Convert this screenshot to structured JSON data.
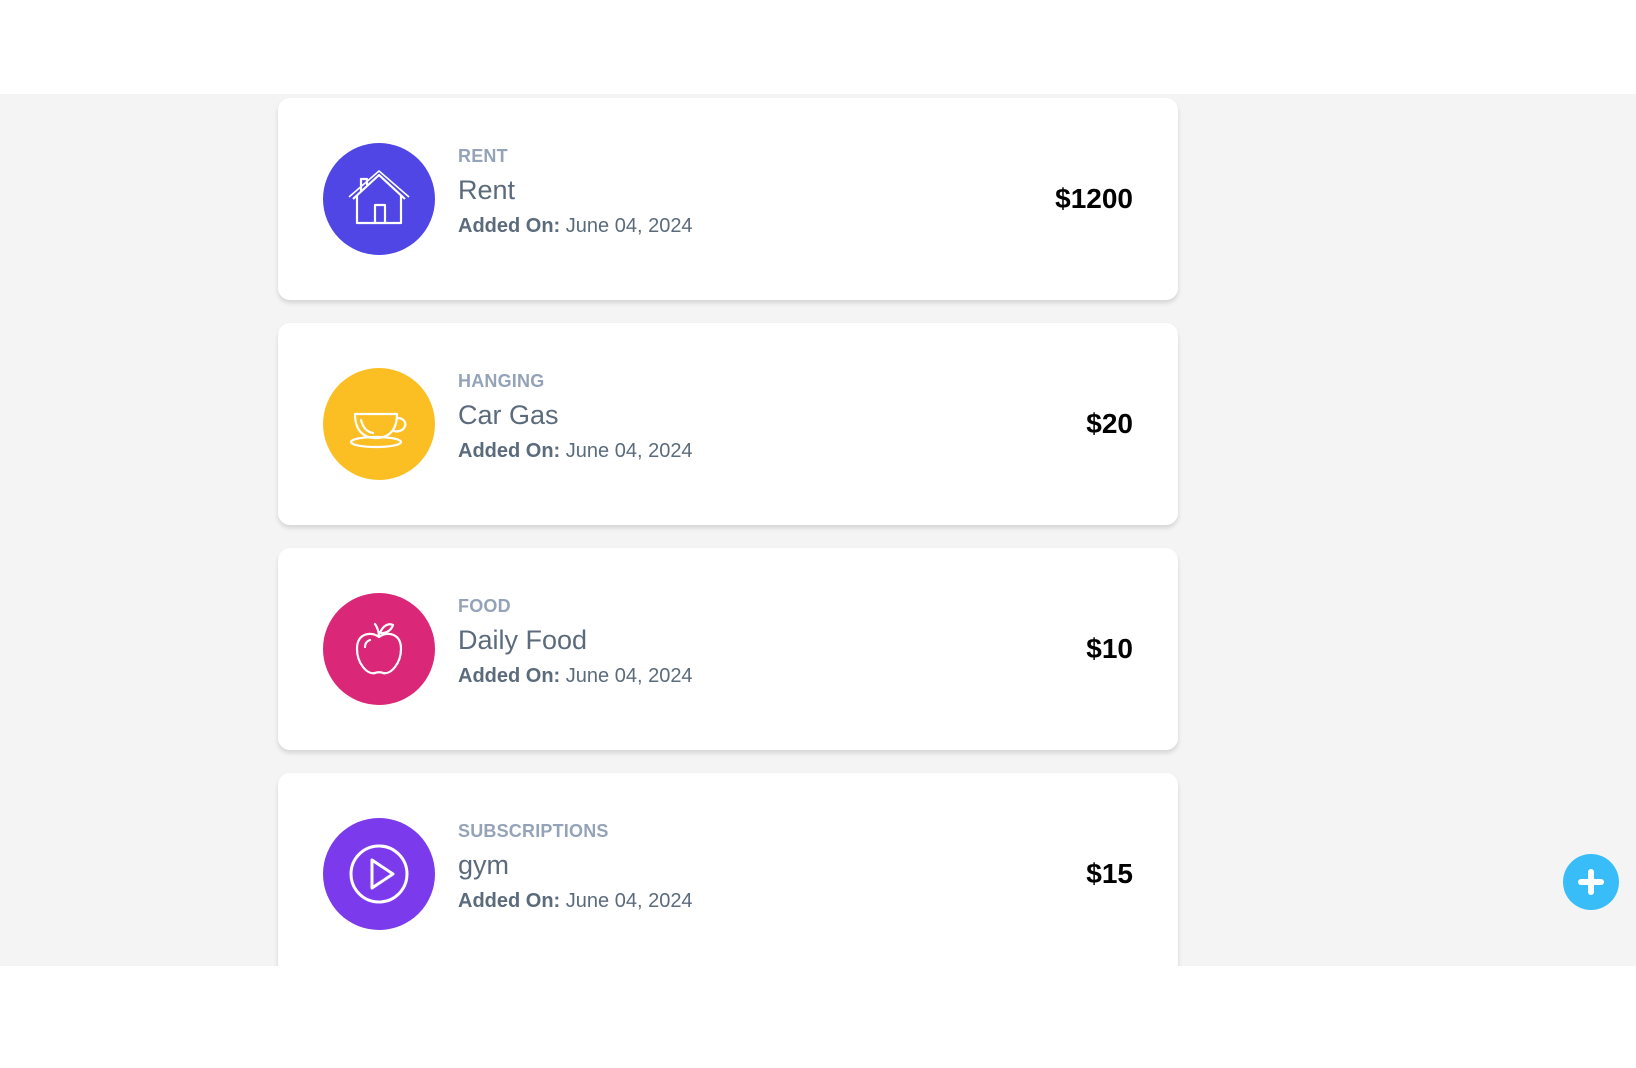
{
  "expenses": [
    {
      "category": "RENT",
      "title": "Rent",
      "added_label": "Added On:",
      "date": "June 04, 2024",
      "amount": "$1200",
      "icon": "house-icon",
      "color": "#4f46e5"
    },
    {
      "category": "HANGING",
      "title": "Car Gas",
      "added_label": "Added On:",
      "date": "June 04, 2024",
      "amount": "$20",
      "icon": "coffee-cup-icon",
      "color": "#fbbf24"
    },
    {
      "category": "FOOD",
      "title": "Daily Food",
      "added_label": "Added On:",
      "date": "June 04, 2024",
      "amount": "$10",
      "icon": "apple-icon",
      "color": "#db2777"
    },
    {
      "category": "SUBSCRIPTIONS",
      "title": "gym",
      "added_label": "Added On:",
      "date": "June 04, 2024",
      "amount": "$15",
      "icon": "play-icon",
      "color": "#7c3aed"
    }
  ],
  "fab": {
    "icon": "plus-icon",
    "color": "#38bdf8"
  }
}
